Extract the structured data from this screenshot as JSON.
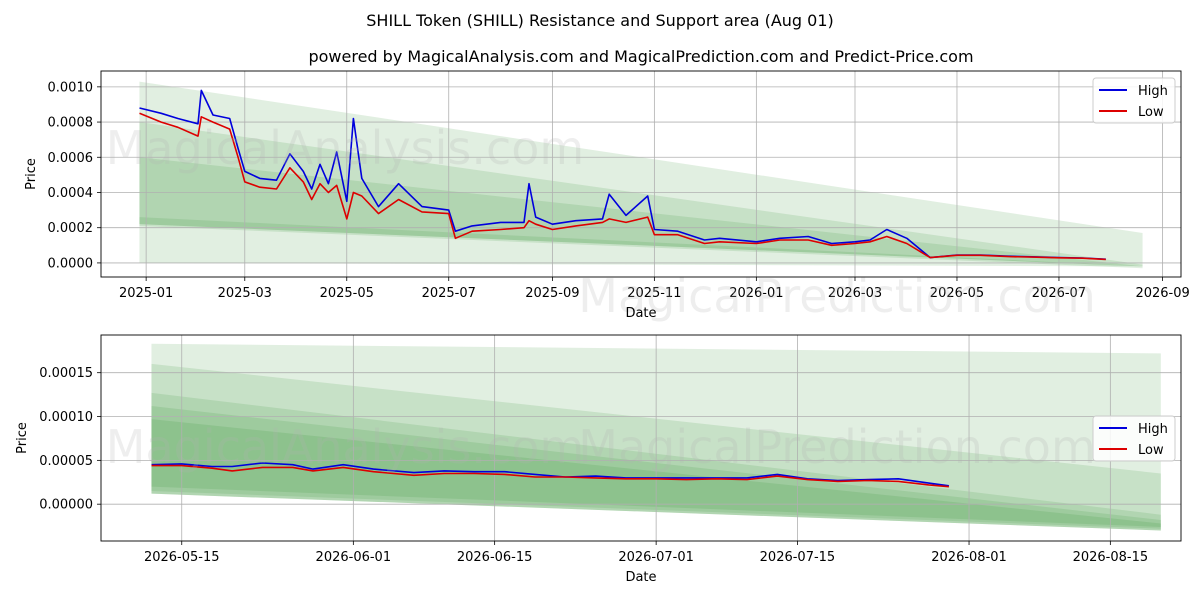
{
  "title": "SHILL Token (SHILL) Resistance and Support area (Aug 01)",
  "subtitle": "powered by MagicalAnalysis.com and MagicalPrediction.com and Predict-Price.com",
  "watermarks": [
    "MagicalAnalysis.com",
    "MagicalPrediction.com"
  ],
  "colors": {
    "high": "#0000dd",
    "low": "#dd0000",
    "band": "#2e8b2e",
    "grid": "#b0b0b0"
  },
  "chart_data": [
    {
      "type": "line",
      "xlabel": "Date",
      "ylabel": "Price",
      "x_ticks": [
        "2025-01",
        "2025-03",
        "2025-05",
        "2025-07",
        "2025-09",
        "2025-11",
        "2026-01",
        "2026-03",
        "2026-05",
        "2026-07",
        "2026-09"
      ],
      "y_ticks": [
        "0.0000",
        "0.0002",
        "0.0004",
        "0.0006",
        "0.0008",
        "0.0010"
      ],
      "xlim": [
        "2024-12-05",
        "2026-09-12"
      ],
      "ylim": [
        -8e-05,
        0.00109
      ],
      "grid": true,
      "legend": "top-right",
      "series": [
        {
          "name": "High",
          "x": [
            "2024-12-28",
            "2025-01-10",
            "2025-01-20",
            "2025-02-01",
            "2025-02-03",
            "2025-02-10",
            "2025-02-20",
            "2025-02-25",
            "2025-03-01",
            "2025-03-10",
            "2025-03-20",
            "2025-03-28",
            "2025-04-05",
            "2025-04-10",
            "2025-04-15",
            "2025-04-20",
            "2025-04-25",
            "2025-05-01",
            "2025-05-05",
            "2025-05-10",
            "2025-05-20",
            "2025-06-01",
            "2025-06-15",
            "2025-07-01",
            "2025-07-05",
            "2025-07-15",
            "2025-08-01",
            "2025-08-15",
            "2025-08-18",
            "2025-08-22",
            "2025-09-01",
            "2025-09-15",
            "2025-10-01",
            "2025-10-05",
            "2025-10-15",
            "2025-10-28",
            "2025-11-01",
            "2025-11-15",
            "2025-12-01",
            "2025-12-10",
            "2026-01-01",
            "2026-01-15",
            "2026-02-01",
            "2026-02-15",
            "2026-03-01",
            "2026-03-10",
            "2026-03-20",
            "2026-04-01",
            "2026-04-15",
            "2026-05-01",
            "2026-05-15",
            "2026-06-01",
            "2026-06-15",
            "2026-07-01",
            "2026-07-15",
            "2026-07-29"
          ],
          "values": [
            0.00088,
            0.00085,
            0.00082,
            0.00079,
            0.00098,
            0.00084,
            0.00082,
            0.00065,
            0.00052,
            0.00048,
            0.00047,
            0.00062,
            0.00052,
            0.00042,
            0.00056,
            0.00045,
            0.00063,
            0.00035,
            0.00082,
            0.00048,
            0.00032,
            0.00045,
            0.00032,
            0.0003,
            0.00018,
            0.00021,
            0.00023,
            0.00023,
            0.00045,
            0.00026,
            0.00022,
            0.00024,
            0.00025,
            0.00039,
            0.00027,
            0.00038,
            0.00019,
            0.00018,
            0.00013,
            0.00014,
            0.00012,
            0.00014,
            0.00015,
            0.00011,
            0.00012,
            0.00013,
            0.00019,
            0.00014,
            3e-05,
            4.5e-05,
            4.5e-05,
            3.8e-05,
            3.5e-05,
            3e-05,
            2.8e-05,
            2.1e-05
          ]
        },
        {
          "name": "Low",
          "x": [
            "2024-12-28",
            "2025-01-10",
            "2025-01-20",
            "2025-02-01",
            "2025-02-03",
            "2025-02-10",
            "2025-02-20",
            "2025-02-25",
            "2025-03-01",
            "2025-03-10",
            "2025-03-20",
            "2025-03-28",
            "2025-04-05",
            "2025-04-10",
            "2025-04-15",
            "2025-04-20",
            "2025-04-25",
            "2025-05-01",
            "2025-05-05",
            "2025-05-10",
            "2025-05-20",
            "2025-06-01",
            "2025-06-15",
            "2025-07-01",
            "2025-07-05",
            "2025-07-15",
            "2025-08-01",
            "2025-08-15",
            "2025-08-18",
            "2025-08-22",
            "2025-09-01",
            "2025-09-15",
            "2025-10-01",
            "2025-10-05",
            "2025-10-15",
            "2025-10-28",
            "2025-11-01",
            "2025-11-15",
            "2025-12-01",
            "2025-12-10",
            "2026-01-01",
            "2026-01-15",
            "2026-02-01",
            "2026-02-15",
            "2026-03-01",
            "2026-03-10",
            "2026-03-20",
            "2026-04-01",
            "2026-04-15",
            "2026-05-01",
            "2026-05-15",
            "2026-06-01",
            "2026-06-15",
            "2026-07-01",
            "2026-07-15",
            "2026-07-29"
          ],
          "values": [
            0.00085,
            0.0008,
            0.00077,
            0.00072,
            0.00083,
            0.0008,
            0.00076,
            0.0006,
            0.00046,
            0.00043,
            0.00042,
            0.00054,
            0.00046,
            0.00036,
            0.00045,
            0.0004,
            0.00044,
            0.00025,
            0.0004,
            0.00038,
            0.00028,
            0.00036,
            0.00029,
            0.00028,
            0.00014,
            0.00018,
            0.00019,
            0.0002,
            0.00024,
            0.00022,
            0.00019,
            0.00021,
            0.00023,
            0.00025,
            0.00023,
            0.00026,
            0.00016,
            0.00016,
            0.00011,
            0.00012,
            0.00011,
            0.00013,
            0.00013,
            0.0001,
            0.00011,
            0.00012,
            0.00015,
            0.00011,
            3e-05,
            4.3e-05,
            4.3e-05,
            3.6e-05,
            3.3e-05,
            2.9e-05,
            2.7e-05,
            2e-05
          ]
        }
      ],
      "bands": [
        {
          "x": [
            "2024-12-28",
            "2026-08-20"
          ],
          "upper": [
            0.00103,
            0.00017
          ],
          "lower": [
            0.0,
            -2e-05
          ]
        },
        {
          "x": [
            "2024-12-28",
            "2026-08-20"
          ],
          "upper": [
            0.0008,
            -1e-05
          ],
          "lower": [
            0.00022,
            -2e-05
          ]
        },
        {
          "x": [
            "2024-12-28",
            "2026-08-20"
          ],
          "upper": [
            0.0006,
            -2e-05
          ],
          "lower": [
            0.00022,
            -2e-05
          ]
        },
        {
          "x": [
            "2024-12-28",
            "2026-08-20"
          ],
          "upper": [
            0.00026,
            -2e-05
          ],
          "lower": [
            0.00021,
            -3e-05
          ]
        }
      ]
    },
    {
      "type": "line",
      "xlabel": "Date",
      "ylabel": "Price",
      "x_ticks": [
        "2026-05-15",
        "2026-06-01",
        "2026-06-15",
        "2026-07-01",
        "2026-07-15",
        "2026-08-01",
        "2026-08-15"
      ],
      "y_ticks": [
        "0.00000",
        "0.00005",
        "0.00010",
        "0.00015"
      ],
      "xlim": [
        "2026-05-07",
        "2026-08-22"
      ],
      "ylim": [
        -4.2e-05,
        0.000193
      ],
      "grid": true,
      "legend": "center-right",
      "series": [
        {
          "name": "High",
          "x": [
            "2026-05-12",
            "2026-05-15",
            "2026-05-18",
            "2026-05-20",
            "2026-05-23",
            "2026-05-26",
            "2026-05-28",
            "2026-05-31",
            "2026-06-03",
            "2026-06-07",
            "2026-06-10",
            "2026-06-13",
            "2026-06-16",
            "2026-06-19",
            "2026-06-22",
            "2026-06-25",
            "2026-06-28",
            "2026-07-01",
            "2026-07-04",
            "2026-07-07",
            "2026-07-10",
            "2026-07-13",
            "2026-07-16",
            "2026-07-19",
            "2026-07-22",
            "2026-07-25",
            "2026-07-28",
            "2026-07-30"
          ],
          "values": [
            4.5e-05,
            4.6e-05,
            4.3e-05,
            4.3e-05,
            4.7e-05,
            4.5e-05,
            4e-05,
            4.5e-05,
            4e-05,
            3.6e-05,
            3.8e-05,
            3.7e-05,
            3.7e-05,
            3.4e-05,
            3.1e-05,
            3.2e-05,
            3e-05,
            3e-05,
            3e-05,
            3e-05,
            3e-05,
            3.4e-05,
            2.9e-05,
            2.7e-05,
            2.8e-05,
            2.9e-05,
            2.4e-05,
            2.1e-05
          ]
        },
        {
          "name": "Low",
          "x": [
            "2026-05-12",
            "2026-05-15",
            "2026-05-18",
            "2026-05-20",
            "2026-05-23",
            "2026-05-26",
            "2026-05-28",
            "2026-05-31",
            "2026-06-03",
            "2026-06-07",
            "2026-06-10",
            "2026-06-13",
            "2026-06-16",
            "2026-06-19",
            "2026-06-22",
            "2026-06-25",
            "2026-06-28",
            "2026-07-01",
            "2026-07-04",
            "2026-07-07",
            "2026-07-10",
            "2026-07-13",
            "2026-07-16",
            "2026-07-19",
            "2026-07-22",
            "2026-07-25",
            "2026-07-28",
            "2026-07-30"
          ],
          "values": [
            4.4e-05,
            4.4e-05,
            4.1e-05,
            3.8e-05,
            4.2e-05,
            4.2e-05,
            3.8e-05,
            4.2e-05,
            3.7e-05,
            3.3e-05,
            3.5e-05,
            3.5e-05,
            3.4e-05,
            3.1e-05,
            3.1e-05,
            3e-05,
            2.9e-05,
            2.9e-05,
            2.8e-05,
            2.9e-05,
            2.8e-05,
            3.2e-05,
            2.8e-05,
            2.6e-05,
            2.7e-05,
            2.6e-05,
            2.2e-05,
            2e-05
          ]
        }
      ],
      "bands": [
        {
          "x": [
            "2026-05-12",
            "2026-08-20"
          ],
          "upper": [
            0.000183,
            0.000172
          ],
          "lower": [
            1.2e-05,
            -3e-05
          ]
        },
        {
          "x": [
            "2026-05-12",
            "2026-08-20"
          ],
          "upper": [
            0.00016,
            3.5e-05
          ],
          "lower": [
            1.2e-05,
            -3e-05
          ]
        },
        {
          "x": [
            "2026-05-12",
            "2026-08-20"
          ],
          "upper": [
            0.000127,
            -1.2e-05
          ],
          "lower": [
            1.2e-05,
            -3e-05
          ]
        },
        {
          "x": [
            "2026-05-12",
            "2026-08-20"
          ],
          "upper": [
            0.000112,
            -1.8e-05
          ],
          "lower": [
            1.5e-05,
            -2.8e-05
          ]
        },
        {
          "x": [
            "2026-05-12",
            "2026-08-20"
          ],
          "upper": [
            9.7e-05,
            -2.2e-05
          ],
          "lower": [
            2e-05,
            -2.6e-05
          ]
        }
      ]
    }
  ]
}
